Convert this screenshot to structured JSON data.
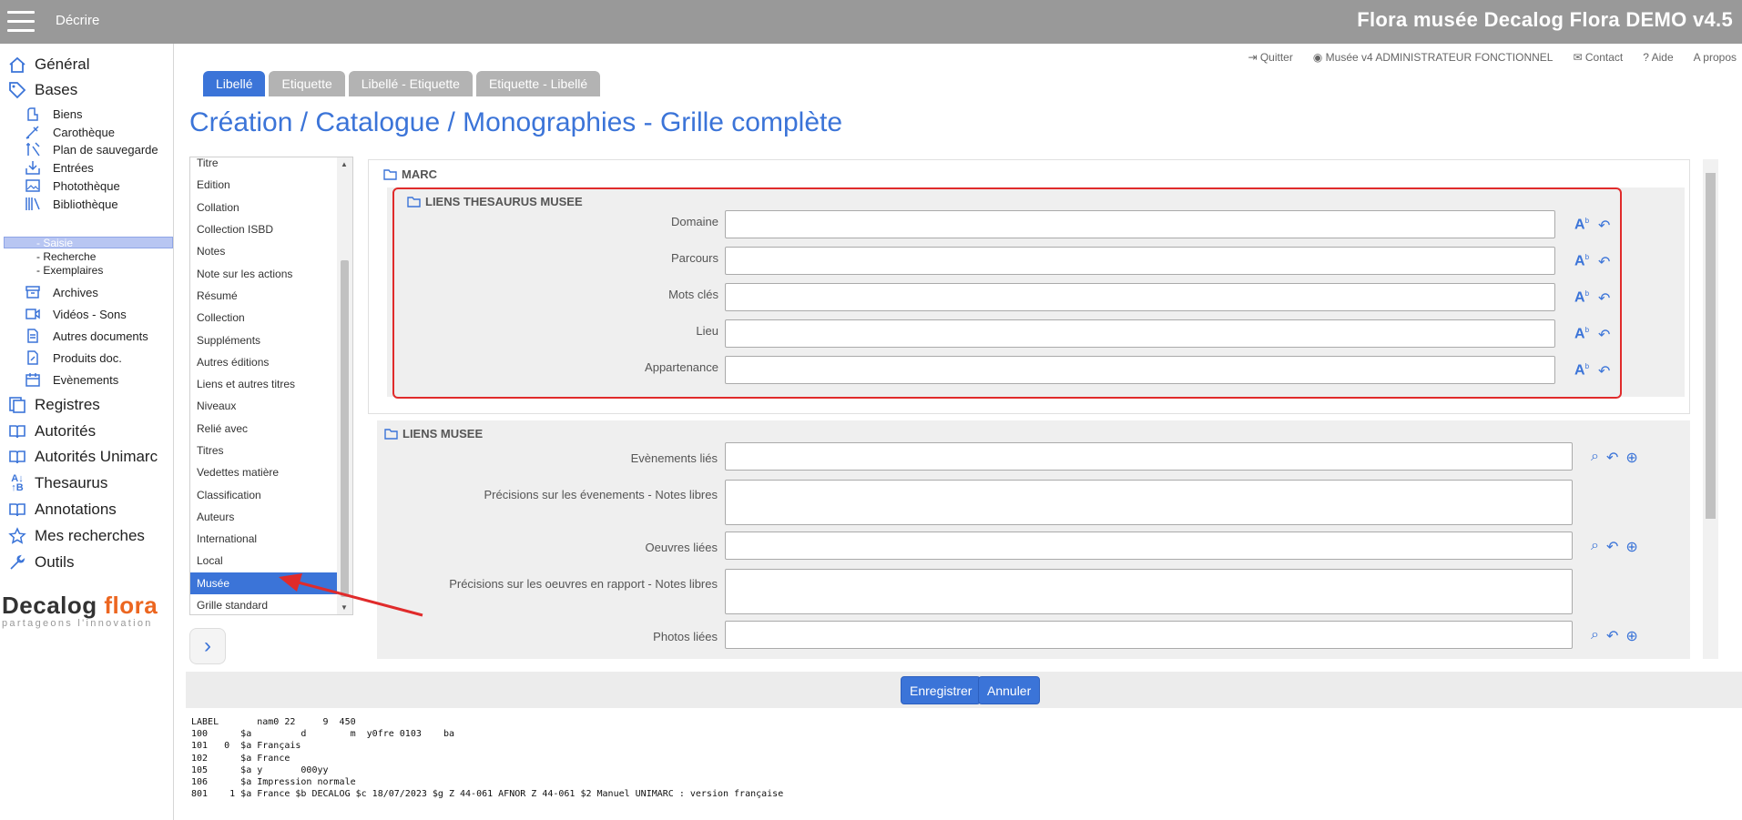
{
  "topbar": {
    "mode": "Décrire",
    "title": "Flora musée Decalog Flora DEMO v4.5"
  },
  "sidebar": {
    "general": "Général",
    "bases": "Bases",
    "biens": "Biens",
    "carotheque": "Carothèque",
    "plan": "Plan de sauvegarde",
    "entrees": "Entrées",
    "phototheque": "Photothèque",
    "bibliotheque": "Bibliothèque",
    "saisie": "- Saisie",
    "recherche": "- Recherche",
    "exemplaires": "- Exemplaires",
    "archives": "Archives",
    "videos": "Vidéos - Sons",
    "autres_docs": "Autres documents",
    "produits": "Produits doc.",
    "evenements": "Evènements",
    "registres": "Registres",
    "autorites": "Autorités",
    "autorites_unimarc": "Autorités Unimarc",
    "thesaurus": "Thesaurus",
    "annotations": "Annotations",
    "mes_recherches": "Mes recherches",
    "outils": "Outils"
  },
  "logo": {
    "brand_a": "Decalog",
    "brand_b": "flora",
    "tagline": "partageons l'innovation"
  },
  "header_links": {
    "quitter": "Quitter",
    "user": "Musée v4 ADMINISTRATEUR FONCTIONNEL",
    "contact": "Contact",
    "aide": "Aide",
    "apropos": "A propos"
  },
  "tabs": [
    "Libellé",
    "Etiquette",
    "Libellé - Etiquette",
    "Etiquette - Libellé"
  ],
  "page_title": "Création / Catalogue / Monographies - Grille complète",
  "sections": [
    "Titre",
    "Edition",
    "Collation",
    "Collection ISBD",
    "Notes",
    "Note sur les actions",
    "Résumé",
    "Collection",
    "Suppléments",
    "Autres éditions",
    "Liens et autres titres",
    "Niveaux",
    "Relié avec",
    "Titres",
    "Vedettes matière",
    "Classification",
    "Auteurs",
    "International",
    "Local",
    "Musée",
    "Grille standard"
  ],
  "form": {
    "marc_legend": "MARC",
    "thes_legend": "LIENS THESAURUS MUSEE",
    "thes_fields": [
      "Domaine",
      "Parcours",
      "Mots clés",
      "Lieu",
      "Appartenance"
    ],
    "musee_legend": "LIENS MUSEE",
    "musee_fields": [
      "Evènements liés",
      "Précisions sur les évenements - Notes libres",
      "Oeuvres liées",
      "Précisions sur les oeuvres en rapport - Notes libres",
      "Photos liées"
    ]
  },
  "buttons": {
    "save": "Enregistrer",
    "cancel": "Annuler"
  },
  "marc_preview": "LABEL       nam0 22     9  450\n100      $a         d        m  y0fre 0103    ba\n101   0  $a Français\n102      $a France\n105      $a y       000yy\n106      $a Impression normale\n801    1 $a France $b DECALOG $c 18/07/2023 $g Z 44-061 AFNOR Z 44-061 $2 Manuel UNIMARC : version française",
  "colors": {
    "accent": "#3b74d8",
    "topbar": "#999999",
    "highlight": "#e02b2b"
  }
}
